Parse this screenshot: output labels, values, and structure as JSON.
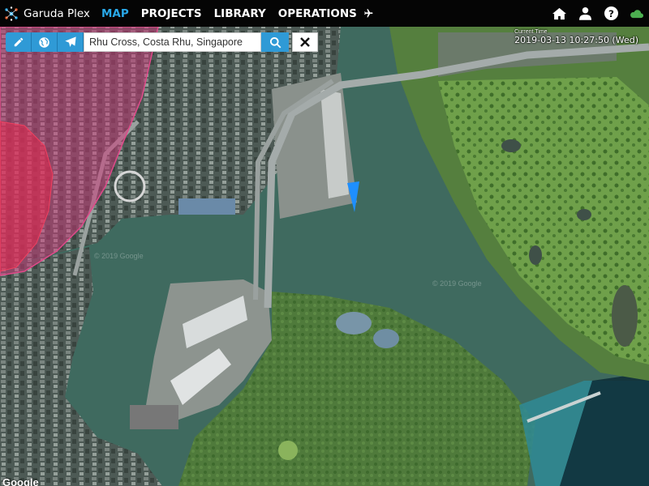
{
  "app": {
    "name": "Garuda Plex"
  },
  "nav": {
    "items": [
      {
        "label": "MAP",
        "active": true
      },
      {
        "label": "PROJECTS",
        "active": false
      },
      {
        "label": "LIBRARY",
        "active": false
      },
      {
        "label": "OPERATIONS",
        "active": false,
        "icon": "plane-icon"
      }
    ]
  },
  "header_icons": [
    "home-icon",
    "user-icon",
    "help-icon",
    "cloud-icon"
  ],
  "toolbar": {
    "tools": [
      "pencil-icon",
      "globe-icon",
      "send-icon"
    ],
    "search_value": "Rhu Cross, Costa Rhu, Singapore",
    "search_icon": "search-icon",
    "clear_icon": "close-icon"
  },
  "time": {
    "label": "Current Time",
    "value": "2019-03-13 10:27:50 (Wed)"
  },
  "map": {
    "attribution": "Google",
    "watermark": "© 2019 Google"
  },
  "colors": {
    "accent": "#29a8e8",
    "button": "#2f9ad6",
    "overlay_outer": "#d0357a",
    "overlay_inner": "#e8284e",
    "marker": "#1e8fff",
    "cloud": "#4caf50"
  }
}
